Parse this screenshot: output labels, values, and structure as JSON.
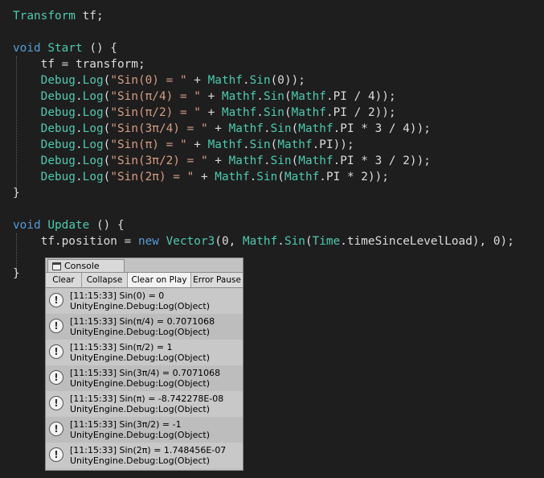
{
  "editor": {
    "lines": [
      [
        [
          "ty",
          "Transform"
        ],
        [
          "pl",
          " tf;"
        ]
      ],
      [],
      [
        [
          "kw",
          "void"
        ],
        [
          "pl",
          " "
        ],
        [
          "ty",
          "Start"
        ],
        [
          "pl",
          " () {"
        ]
      ],
      [
        [
          "pl",
          "    tf = transform;"
        ]
      ],
      [
        [
          "pl",
          "    "
        ],
        [
          "ty",
          "Debug"
        ],
        [
          "pl",
          "."
        ],
        [
          "ty",
          "Log"
        ],
        [
          "pl",
          "("
        ],
        [
          "st",
          "\"Sin(0) = \""
        ],
        [
          "pl",
          " + "
        ],
        [
          "ty",
          "Mathf"
        ],
        [
          "pl",
          "."
        ],
        [
          "ty",
          "Sin"
        ],
        [
          "pl",
          "(0));"
        ]
      ],
      [
        [
          "pl",
          "    "
        ],
        [
          "ty",
          "Debug"
        ],
        [
          "pl",
          "."
        ],
        [
          "ty",
          "Log"
        ],
        [
          "pl",
          "("
        ],
        [
          "st",
          "\"Sin(π/4) = \""
        ],
        [
          "pl",
          " + "
        ],
        [
          "ty",
          "Mathf"
        ],
        [
          "pl",
          "."
        ],
        [
          "ty",
          "Sin"
        ],
        [
          "pl",
          "("
        ],
        [
          "ty",
          "Mathf"
        ],
        [
          "pl",
          ".PI / 4));"
        ]
      ],
      [
        [
          "pl",
          "    "
        ],
        [
          "ty",
          "Debug"
        ],
        [
          "pl",
          "."
        ],
        [
          "ty",
          "Log"
        ],
        [
          "pl",
          "("
        ],
        [
          "st",
          "\"Sin(π/2) = \""
        ],
        [
          "pl",
          " + "
        ],
        [
          "ty",
          "Mathf"
        ],
        [
          "pl",
          "."
        ],
        [
          "ty",
          "Sin"
        ],
        [
          "pl",
          "("
        ],
        [
          "ty",
          "Mathf"
        ],
        [
          "pl",
          ".PI / 2));"
        ]
      ],
      [
        [
          "pl",
          "    "
        ],
        [
          "ty",
          "Debug"
        ],
        [
          "pl",
          "."
        ],
        [
          "ty",
          "Log"
        ],
        [
          "pl",
          "("
        ],
        [
          "st",
          "\"Sin(3π/4) = \""
        ],
        [
          "pl",
          " + "
        ],
        [
          "ty",
          "Mathf"
        ],
        [
          "pl",
          "."
        ],
        [
          "ty",
          "Sin"
        ],
        [
          "pl",
          "("
        ],
        [
          "ty",
          "Mathf"
        ],
        [
          "pl",
          ".PI * 3 / 4));"
        ]
      ],
      [
        [
          "pl",
          "    "
        ],
        [
          "ty",
          "Debug"
        ],
        [
          "pl",
          "."
        ],
        [
          "ty",
          "Log"
        ],
        [
          "pl",
          "("
        ],
        [
          "st",
          "\"Sin(π) = \""
        ],
        [
          "pl",
          " + "
        ],
        [
          "ty",
          "Mathf"
        ],
        [
          "pl",
          "."
        ],
        [
          "ty",
          "Sin"
        ],
        [
          "pl",
          "("
        ],
        [
          "ty",
          "Mathf"
        ],
        [
          "pl",
          ".PI));"
        ]
      ],
      [
        [
          "pl",
          "    "
        ],
        [
          "ty",
          "Debug"
        ],
        [
          "pl",
          "."
        ],
        [
          "ty",
          "Log"
        ],
        [
          "pl",
          "("
        ],
        [
          "st",
          "\"Sin(3π/2) = \""
        ],
        [
          "pl",
          " + "
        ],
        [
          "ty",
          "Mathf"
        ],
        [
          "pl",
          "."
        ],
        [
          "ty",
          "Sin"
        ],
        [
          "pl",
          "("
        ],
        [
          "ty",
          "Mathf"
        ],
        [
          "pl",
          ".PI * 3 / 2));"
        ]
      ],
      [
        [
          "pl",
          "    "
        ],
        [
          "ty",
          "Debug"
        ],
        [
          "pl",
          "."
        ],
        [
          "ty",
          "Log"
        ],
        [
          "pl",
          "("
        ],
        [
          "st",
          "\"Sin(2π) = \""
        ],
        [
          "pl",
          " + "
        ],
        [
          "ty",
          "Mathf"
        ],
        [
          "pl",
          "."
        ],
        [
          "ty",
          "Sin"
        ],
        [
          "pl",
          "("
        ],
        [
          "ty",
          "Mathf"
        ],
        [
          "pl",
          ".PI * 2));"
        ]
      ],
      [
        [
          "pl",
          "}"
        ]
      ],
      [],
      [
        [
          "kw",
          "void"
        ],
        [
          "pl",
          " "
        ],
        [
          "ty",
          "Update"
        ],
        [
          "pl",
          " () {"
        ]
      ],
      [
        [
          "pl",
          "    tf.position = "
        ],
        [
          "kw",
          "new"
        ],
        [
          "pl",
          " "
        ],
        [
          "ty",
          "Vector3"
        ],
        [
          "pl",
          "(0, "
        ],
        [
          "ty",
          "Mathf"
        ],
        [
          "pl",
          "."
        ],
        [
          "ty",
          "Sin"
        ],
        [
          "pl",
          "("
        ],
        [
          "ty",
          "Time"
        ],
        [
          "pl",
          ".timeSinceLevelLoad), 0);"
        ]
      ],
      [],
      [
        [
          "pl",
          "}"
        ]
      ]
    ]
  },
  "console": {
    "tab_label": "Console",
    "toolbar": {
      "clear": "Clear",
      "collapse": "Collapse",
      "clear_on_play": "Clear on Play",
      "error_pause": "Error Pause"
    },
    "entries": [
      {
        "message": "[11:15:33] Sin(0) = 0",
        "source": "UnityEngine.Debug:Log(Object)"
      },
      {
        "message": "[11:15:33] Sin(π/4) = 0.7071068",
        "source": "UnityEngine.Debug:Log(Object)"
      },
      {
        "message": "[11:15:33] Sin(π/2) = 1",
        "source": "UnityEngine.Debug:Log(Object)"
      },
      {
        "message": "[11:15:33] Sin(3π/4) = 0.7071068",
        "source": "UnityEngine.Debug:Log(Object)"
      },
      {
        "message": "[11:15:33] Sin(π) = -8.742278E-08",
        "source": "UnityEngine.Debug:Log(Object)"
      },
      {
        "message": "[11:15:33] Sin(3π/2) = -1",
        "source": "UnityEngine.Debug:Log(Object)"
      },
      {
        "message": "[11:15:33] Sin(2π) = 1.748456E-07",
        "source": "UnityEngine.Debug:Log(Object)"
      }
    ],
    "info_icon_glyph": "!"
  }
}
